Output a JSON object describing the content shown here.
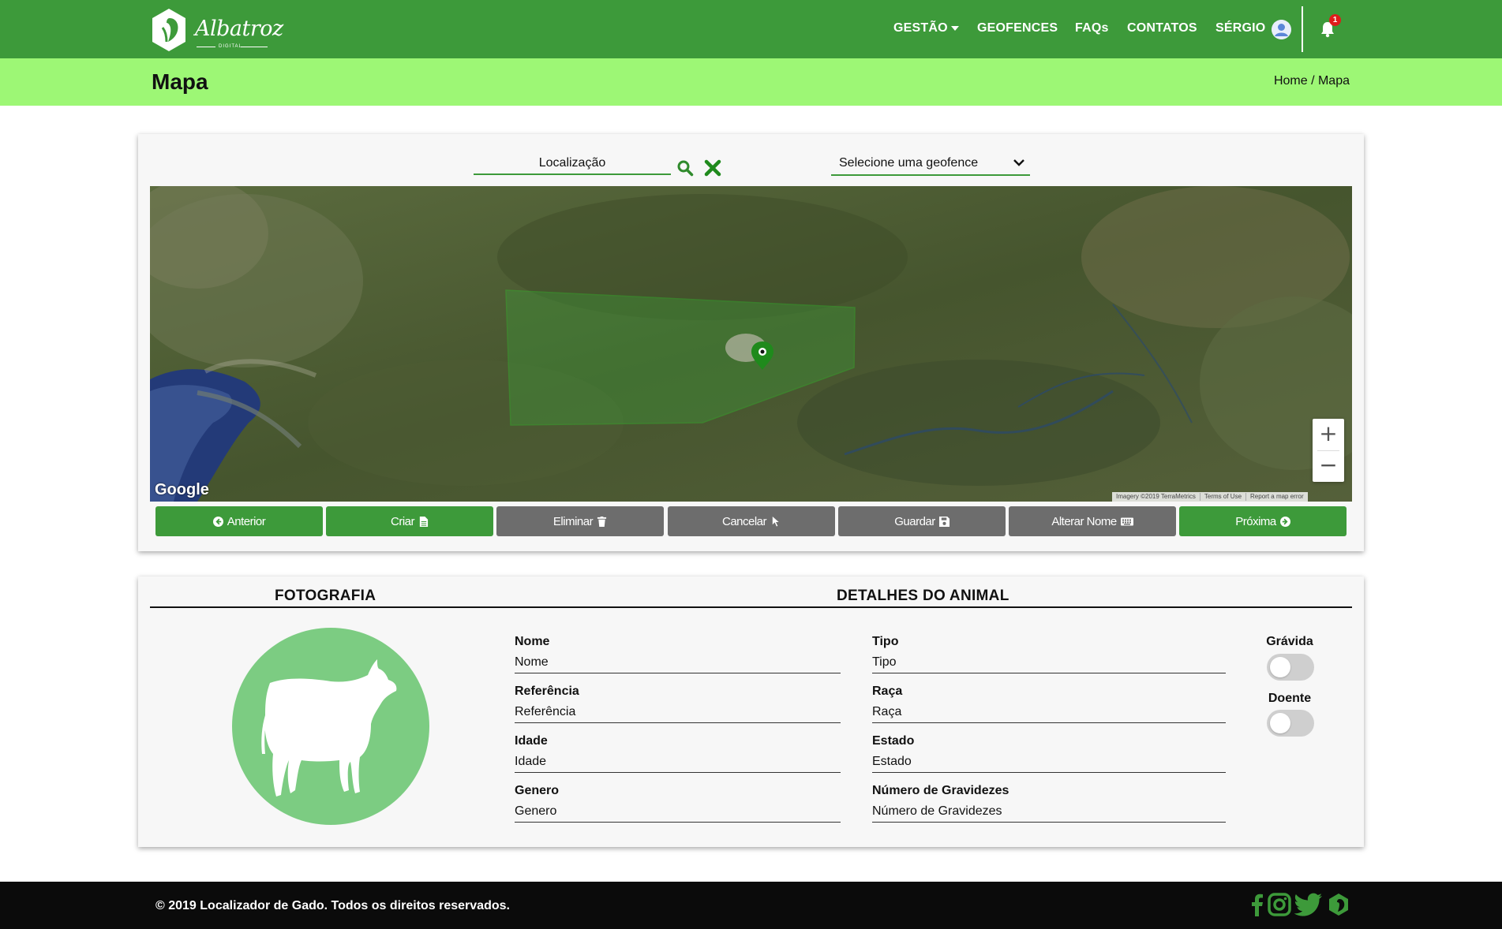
{
  "nav": {
    "brand_name": "Albatroz",
    "brand_sub": "DIGITAL",
    "gestao": "GESTÃO",
    "geofences": "GEOFENCES",
    "faqs": "FAQs",
    "contatos": "CONTATOS",
    "user": "SÉRGIO",
    "notifications_count": "1"
  },
  "header": {
    "title": "Mapa",
    "breadcrumb_home": "Home",
    "breadcrumb_sep": " / ",
    "breadcrumb_current": "Mapa"
  },
  "map_controls": {
    "location_placeholder": "Localização",
    "geofence_select": "Selecione uma geofence"
  },
  "map": {
    "provider": "Google",
    "attribution": [
      "Imagery ©2019 TerraMetrics",
      "Terms of Use",
      "Report a map error"
    ],
    "zoom_in": "+",
    "zoom_out": "−"
  },
  "actions": {
    "anterior": "Anterior",
    "criar": "Criar",
    "eliminar": "Eliminar",
    "cancelar": "Cancelar",
    "guardar": "Guardar",
    "alterar_nome": "Alterar Nome",
    "proxima": "Próxima"
  },
  "details": {
    "photo_title": "FOTOGRAFIA",
    "animal_title": "DETALHES DO ANIMAL",
    "fields": {
      "nome": {
        "label": "Nome",
        "value": "Nome"
      },
      "referencia": {
        "label": "Referência",
        "value": "Referência"
      },
      "idade": {
        "label": "Idade",
        "value": "Idade"
      },
      "genero": {
        "label": "Genero",
        "value": "Genero"
      },
      "tipo": {
        "label": "Tipo",
        "value": "Tipo"
      },
      "raca": {
        "label": "Raça",
        "value": "Raça"
      },
      "estado": {
        "label": "Estado",
        "value": "Estado"
      },
      "gravidezes": {
        "label": "Número de Gravidezes",
        "value": "Número de Gravidezes"
      }
    },
    "gravida_label": "Grávida",
    "doente_label": "Doente"
  },
  "footer": {
    "copyright": "© 2019 Localizador de Gado. Todos os direitos reservados."
  },
  "colors": {
    "primary": "#3d9a3a",
    "subheader": "#9df775",
    "gray_button": "#6d6d6d",
    "cow_circle": "#7ccc82"
  }
}
